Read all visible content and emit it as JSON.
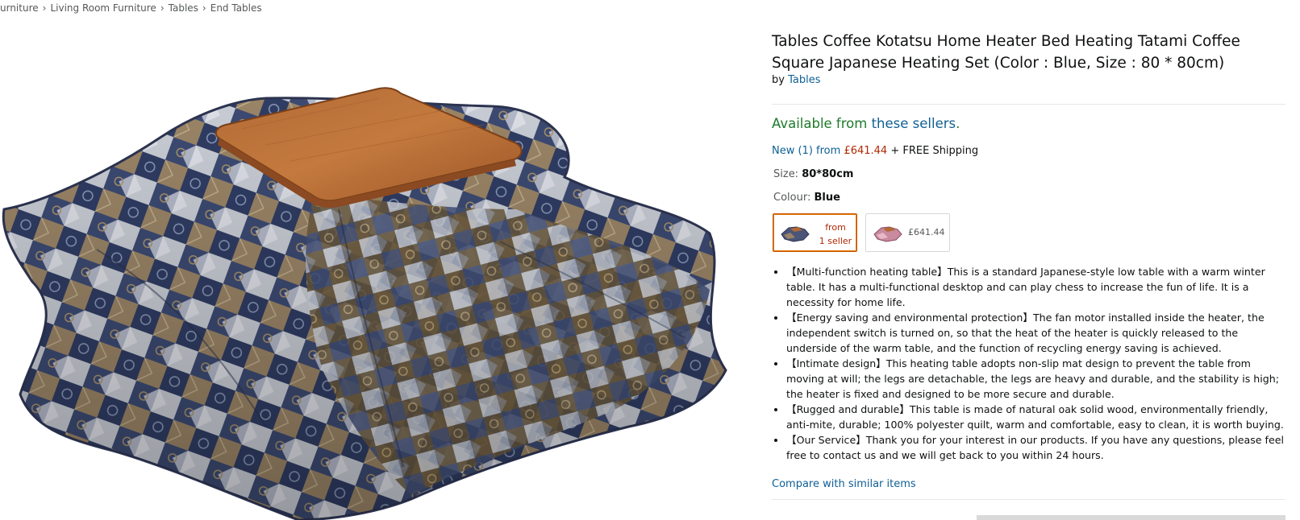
{
  "breadcrumb": {
    "items": [
      "urniture",
      "Living Room Furniture",
      "Tables",
      "End Tables"
    ],
    "separator": "›"
  },
  "product": {
    "title": "Tables Coffee Kotatsu Home Heater Bed Heating Tatami Coffee Square Japanese Heating Set (Color : Blue, Size : 80 * 80cm)",
    "by_prefix": "by",
    "brand": "Tables",
    "image_icon": "product-image-kotatsu"
  },
  "availability": {
    "prefix": "Available from ",
    "link": "these sellers",
    "suffix": "."
  },
  "offer": {
    "new_link": "New (1) from",
    "price": "£641.44",
    "shipping": "+ FREE Shipping"
  },
  "size": {
    "label": "Size:",
    "value": "80*80cm"
  },
  "colour": {
    "label": "Colour:",
    "value": "Blue"
  },
  "swatches": [
    {
      "line1": "from",
      "line2": "1 seller",
      "selected": true
    },
    {
      "price": "£641.44",
      "selected": false
    }
  ],
  "bullets": [
    "【Multi-function heating table】This is a standard Japanese-style low table with a warm winter table. It has a multi-functional desktop and can play chess to increase the fun of life. It is a necessity for home life.",
    "【Energy saving and environmental protection】The fan motor installed inside the heater, the independent switch is turned on, so that the heat of the heater is quickly released to the underside of the warm table, and the function of recycling energy saving is achieved.",
    "【Intimate design】This heating table adopts non-slip mat design to prevent the table from moving at will; the legs are detachable, the legs are heavy and durable, and the stability is high; the heater is fixed and designed to be more secure and durable.",
    "【Rugged and durable】This table is made of natural oak solid wood, environmentally friendly, anti-mite, durable; 100% polyester quilt, warm and comfortable, easy to clean, it is worth buying.",
    "【Our Service】Thank you for your interest in our products. If you have any questions, please feel free to contact us and we will get back to you within 24 hours."
  ],
  "compare_link": "Compare with similar items",
  "colors": {
    "link": "#0f5f94",
    "available_green": "#1e7a2a",
    "price_red": "#b12704",
    "selected_border": "#e77600"
  }
}
